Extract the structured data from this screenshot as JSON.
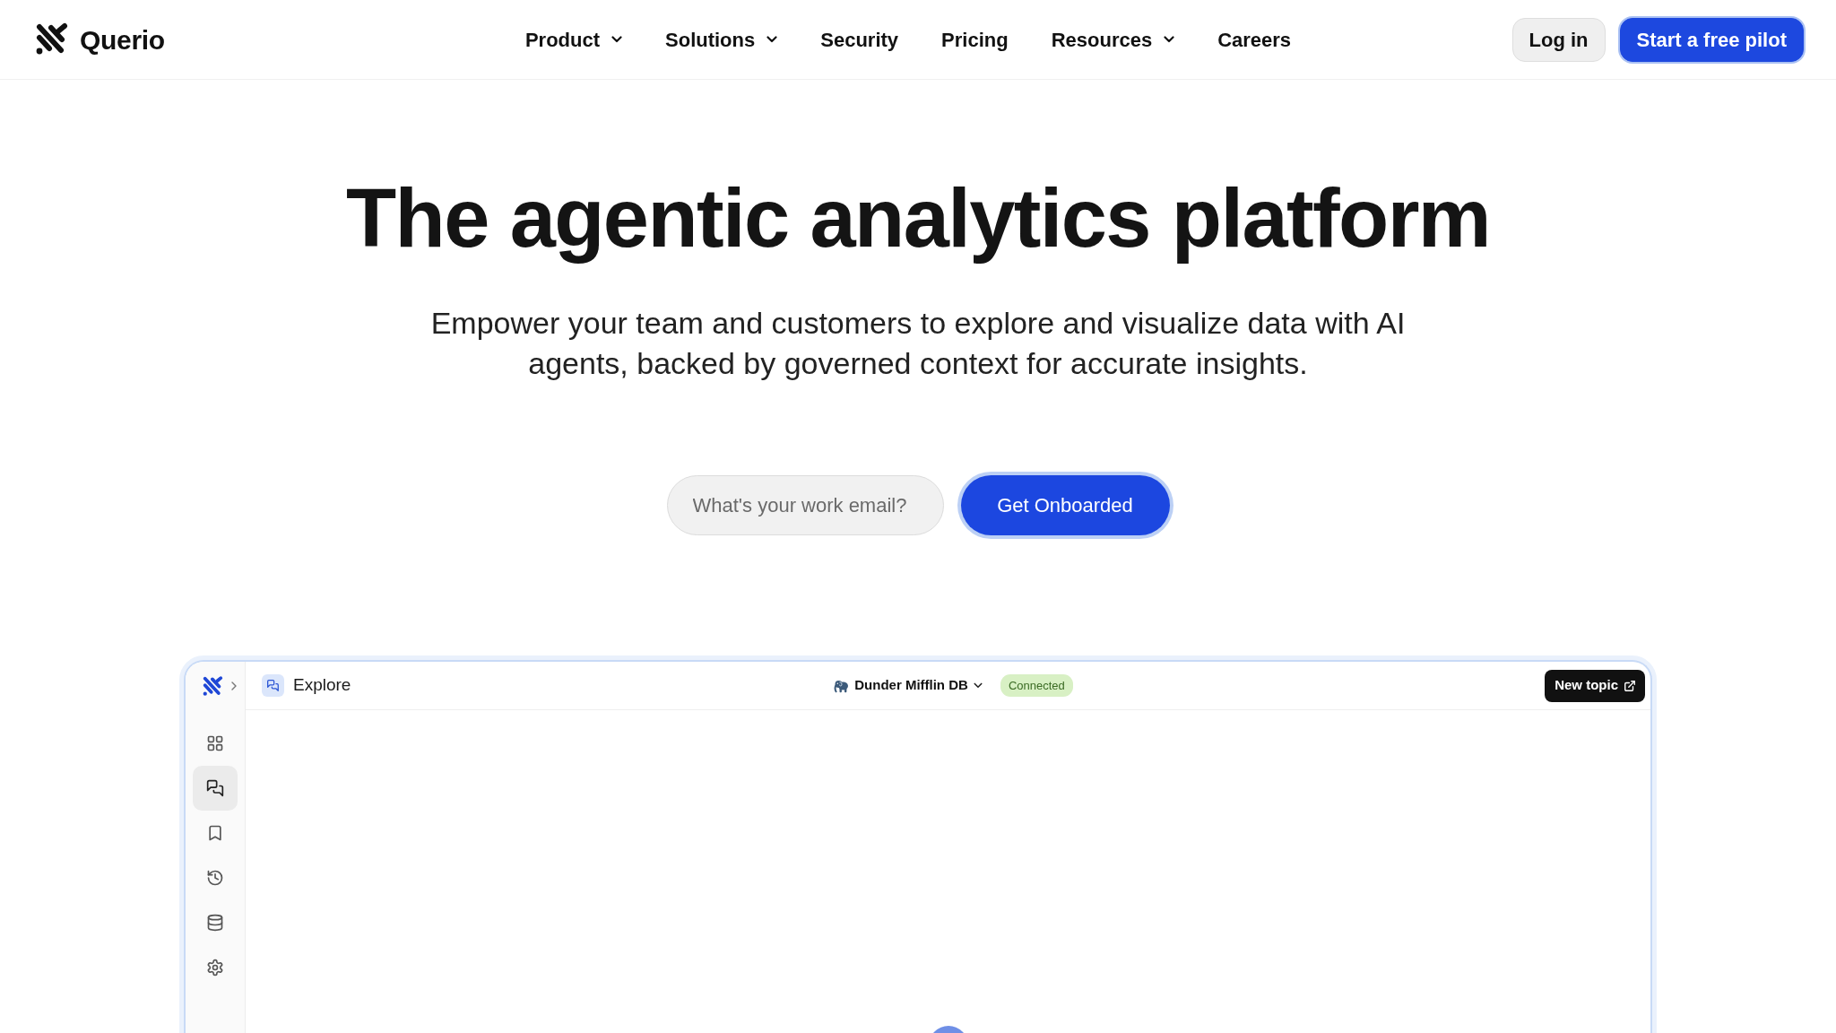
{
  "navbar": {
    "brand": "Querio",
    "links": [
      {
        "label": "Product",
        "dropdown": true
      },
      {
        "label": "Solutions",
        "dropdown": true
      },
      {
        "label": "Security",
        "dropdown": false
      },
      {
        "label": "Pricing",
        "dropdown": false
      },
      {
        "label": "Resources",
        "dropdown": true
      },
      {
        "label": "Careers",
        "dropdown": false
      }
    ],
    "login": "Log in",
    "cta": "Start a free pilot"
  },
  "hero": {
    "title": "The agentic analytics platform",
    "subtitle": "Empower your team and customers to explore and visualize data with AI agents, backed by governed context for accurate insights.",
    "email": {
      "placeholder": "What's your work email?"
    },
    "button": "Get Onboarded"
  },
  "app_preview": {
    "page_title": "Explore",
    "database": "Dunder Mifflin DB",
    "connection_status": "Connected",
    "new_topic": "New topic",
    "sidebar": [
      {
        "kind": "dashboard",
        "selected": false
      },
      {
        "kind": "chat",
        "selected": true
      },
      {
        "kind": "bookmark",
        "selected": false
      },
      {
        "kind": "history",
        "selected": false
      },
      {
        "kind": "database",
        "selected": false
      },
      {
        "kind": "settings",
        "selected": false
      }
    ]
  }
}
